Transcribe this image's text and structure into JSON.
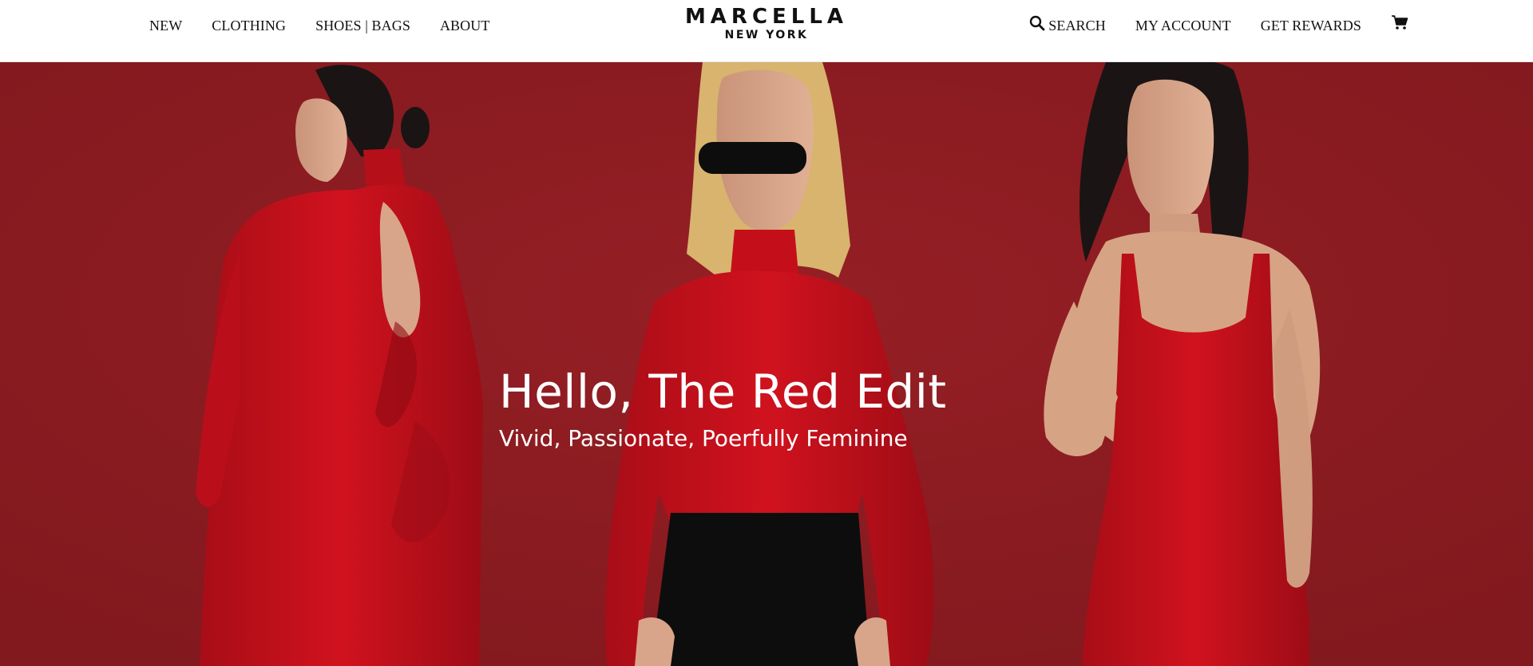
{
  "header": {
    "nav_left": [
      {
        "label": "NEW"
      },
      {
        "label": "CLOTHING"
      },
      {
        "label": "SHOES | BAGS"
      },
      {
        "label": "ABOUT"
      }
    ],
    "logo": {
      "main": "MARCELLA",
      "sub": "NEW YORK"
    },
    "nav_right": {
      "search": "SEARCH",
      "account": "MY ACCOUNT",
      "rewards": "GET REWARDS",
      "cart_icon": "cart-icon",
      "search_icon": "search-icon"
    }
  },
  "hero": {
    "title": "Hello, The Red Edit",
    "subtitle": "Vivid, Passionate, Poerfully Feminine",
    "colors": {
      "background": "#8b1d22",
      "garment_red": "#c8101c",
      "text": "#ffffff"
    }
  }
}
